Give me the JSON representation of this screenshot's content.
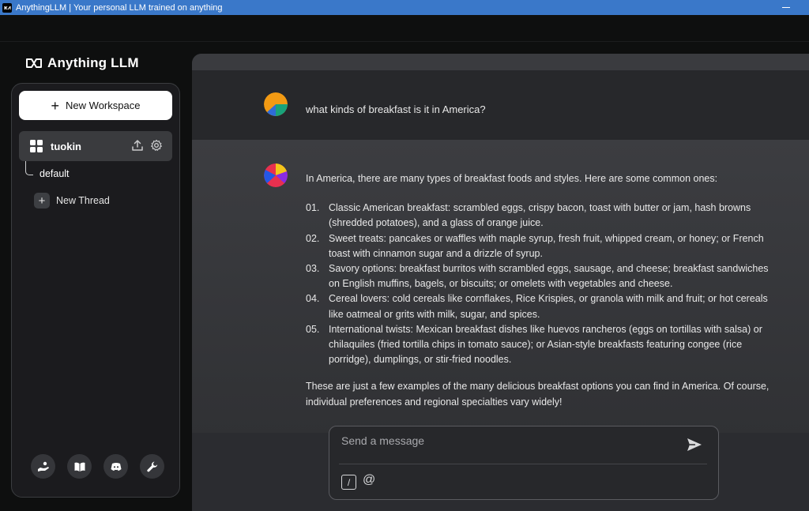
{
  "window": {
    "title": "AnythingLLM | Your personal LLM trained on anything",
    "app_icon": "anythingllm-logo-icon"
  },
  "brand": {
    "logo_text": "Anything LLM",
    "logo_icon": "anythingllm-logo-icon"
  },
  "sidebar": {
    "new_workspace_label": "New Workspace",
    "workspace": {
      "name": "tuokin",
      "icons": [
        "upload-icon",
        "gear-icon"
      ]
    },
    "threads": [
      {
        "label": "default"
      }
    ],
    "new_thread_label": "New Thread",
    "footer_icons": [
      "hand-coin-icon",
      "book-icon",
      "discord-icon",
      "wrench-icon"
    ]
  },
  "chat": {
    "user_message": "what kinds of breakfast is it in America?",
    "assistant": {
      "intro": "In America, there are many types of breakfast foods and styles. Here are some common ones:",
      "items": [
        {
          "num": "01.",
          "text": "Classic American breakfast: scrambled eggs, crispy bacon, toast with butter or jam, hash browns (shredded potatoes), and a glass of orange juice."
        },
        {
          "num": "02.",
          "text": "Sweet treats: pancakes or waffles with maple syrup, fresh fruit, whipped cream, or honey; or French toast with cinnamon sugar and a drizzle of syrup."
        },
        {
          "num": "03.",
          "text": "Savory options: breakfast burritos with scrambled eggs, sausage, and cheese; breakfast sandwiches on English muffins, bagels, or biscuits; or omelets with vegetables and cheese."
        },
        {
          "num": "04.",
          "text": "Cereal lovers: cold cereals like cornflakes, Rice Krispies, or granola with milk and fruit; or hot cereals like oatmeal or grits with milk, sugar, and spices."
        },
        {
          "num": "05.",
          "text": "International twists: Mexican breakfast dishes like huevos rancheros (eggs on tortillas with salsa) or chilaquiles (fried tortilla chips in tomato sauce); or Asian-style breakfasts featuring congee (rice porridge), dumplings, or stir-fried noodles."
        }
      ],
      "outro": "These are just a few examples of the many delicious breakfast options you can find in America. Of course, individual preferences and regional specialties vary widely!"
    }
  },
  "composer": {
    "placeholder": "Send a message",
    "slash_label": "/",
    "at_label": "@"
  },
  "colors": {
    "titlebar": "#3a78c9",
    "background": "#0e0f0f",
    "sidebar": "#1b1b1e",
    "chat": "#2b2c30",
    "accent_white": "#ffffff"
  }
}
